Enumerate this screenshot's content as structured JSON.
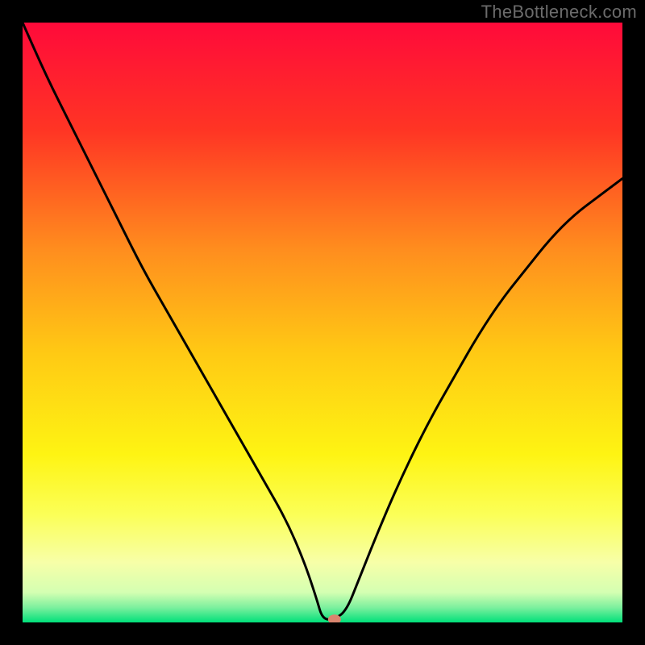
{
  "watermark": "TheBottleneck.com",
  "chart_data": {
    "type": "line",
    "title": "",
    "xlabel": "",
    "ylabel": "",
    "xlim": [
      0,
      100
    ],
    "ylim": [
      0,
      100
    ],
    "grid": false,
    "background_gradient": {
      "type": "vertical",
      "stops": [
        {
          "offset": 0.0,
          "color": "#ff0a3a"
        },
        {
          "offset": 0.18,
          "color": "#ff3524"
        },
        {
          "offset": 0.38,
          "color": "#ff8e1e"
        },
        {
          "offset": 0.55,
          "color": "#ffc914"
        },
        {
          "offset": 0.72,
          "color": "#fef413"
        },
        {
          "offset": 0.82,
          "color": "#fbff57"
        },
        {
          "offset": 0.9,
          "color": "#f7ffa8"
        },
        {
          "offset": 0.95,
          "color": "#d4ffb2"
        },
        {
          "offset": 0.975,
          "color": "#7df09e"
        },
        {
          "offset": 1.0,
          "color": "#00e07a"
        }
      ]
    },
    "series": [
      {
        "name": "bottleneck-curve",
        "color": "#000000",
        "stroke_width": 3,
        "x": [
          0,
          4,
          8,
          12,
          16,
          20,
          24,
          28,
          32,
          36,
          40,
          44,
          47,
          49,
          50,
          52,
          54,
          56,
          60,
          64,
          68,
          72,
          76,
          80,
          84,
          88,
          92,
          96,
          100
        ],
        "y": [
          100,
          91,
          83,
          75,
          67,
          59,
          52,
          45,
          38,
          31,
          24,
          17,
          10,
          4,
          0.5,
          0.5,
          2,
          7,
          17,
          26,
          34,
          41,
          48,
          54,
          59,
          64,
          68,
          71,
          74
        ]
      }
    ],
    "marker": {
      "name": "minimum-marker",
      "x": 52,
      "y": 0.5,
      "color": "#d9856f",
      "rx": 8,
      "ry": 6
    }
  }
}
